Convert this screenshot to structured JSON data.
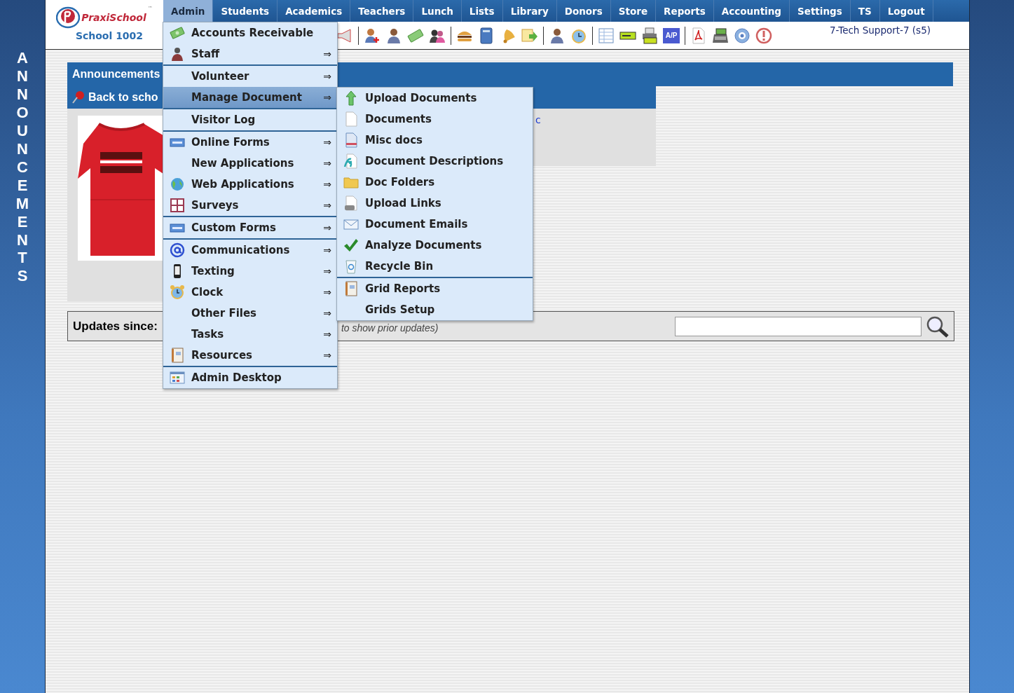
{
  "logo": {
    "name": "PraxiSchool",
    "mark": "™",
    "school": "School 1002"
  },
  "side_banner": "ANNOUNCEMENTS",
  "nav": [
    {
      "label": "Admin",
      "selected": true
    },
    {
      "label": "Students",
      "selected": false
    },
    {
      "label": "Academics",
      "selected": false
    },
    {
      "label": "Teachers",
      "selected": false
    },
    {
      "label": "Lunch",
      "selected": false
    },
    {
      "label": "Lists",
      "selected": false
    },
    {
      "label": "Library",
      "selected": false
    },
    {
      "label": "Donors",
      "selected": false
    },
    {
      "label": "Store",
      "selected": false
    },
    {
      "label": "Reports",
      "selected": false
    },
    {
      "label": "Accounting",
      "selected": false
    },
    {
      "label": "Settings",
      "selected": false
    },
    {
      "label": "TS",
      "selected": false
    },
    {
      "label": "Logout",
      "selected": false
    }
  ],
  "toolbar": {
    "ap_label": "A/P",
    "user": "7-Tech Support-7 (s5)"
  },
  "announcements": {
    "title": "Announcements",
    "post_title": "Back to scho",
    "link": "c",
    "kind": "picture"
  },
  "updates": {
    "label": "Updates since:",
    "hint": "to show prior updates)"
  },
  "admin_menu": [
    [
      {
        "label": "Accounts Receivable",
        "selected": false
      },
      {
        "label": "Staff",
        "arrow": "⇒",
        "selected": false
      }
    ],
    [
      {
        "label": "Volunteer",
        "arrow": "⇒",
        "selected": false
      },
      {
        "label": "Manage Document",
        "arrow": "⇒",
        "selected": true
      }
    ],
    [
      {
        "label": "Visitor Log",
        "selected": false
      }
    ],
    [
      {
        "label": "Online Forms",
        "arrow": "⇒",
        "selected": false
      },
      {
        "label": "New Applications",
        "arrow": "⇒",
        "selected": false
      },
      {
        "label": "Web Applications",
        "arrow": "⇒",
        "selected": false
      },
      {
        "label": "Surveys",
        "arrow": "⇒",
        "selected": false
      }
    ],
    [
      {
        "label": "Custom Forms",
        "arrow": "⇒",
        "selected": false
      }
    ],
    [
      {
        "label": "Communications",
        "arrow": "⇒",
        "selected": false
      },
      {
        "label": "Texting",
        "arrow": "⇒",
        "selected": false
      },
      {
        "label": "Clock",
        "arrow": "⇒",
        "selected": false
      },
      {
        "label": "Other Files",
        "arrow": "⇒",
        "selected": false
      },
      {
        "label": "Tasks",
        "arrow": "⇒",
        "selected": false
      },
      {
        "label": "Resources",
        "arrow": "⇒",
        "selected": false
      }
    ],
    [
      {
        "label": "Admin Desktop",
        "selected": false
      }
    ]
  ],
  "document_menu": [
    [
      {
        "label": "Upload Documents",
        "selected": false
      },
      {
        "label": "Documents",
        "selected": false
      },
      {
        "label": "Misc docs",
        "selected": false
      },
      {
        "label": "Document Descriptions",
        "selected": false
      },
      {
        "label": "Doc Folders",
        "selected": false
      },
      {
        "label": "Upload Links",
        "selected": false
      },
      {
        "label": "Document Emails",
        "selected": false
      },
      {
        "label": "Analyze Documents",
        "selected": false
      },
      {
        "label": "Recycle Bin",
        "selected": false
      }
    ],
    [
      {
        "label": "Grid Reports",
        "selected": false
      },
      {
        "label": "Grids Setup",
        "selected": false
      }
    ]
  ]
}
